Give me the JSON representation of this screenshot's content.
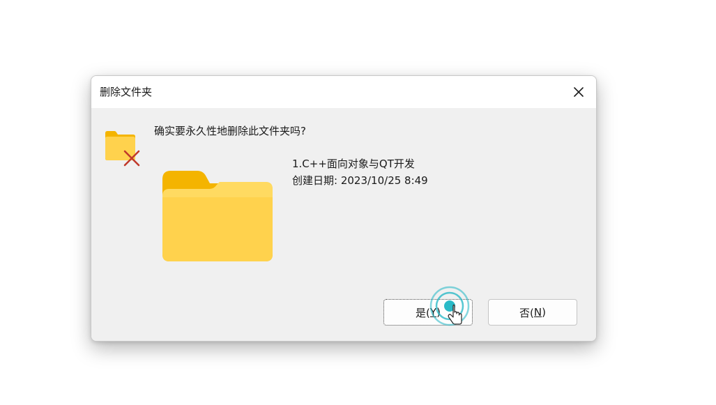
{
  "dialog": {
    "title": "删除文件夹",
    "question": "确实要永久性地删除此文件夹吗?",
    "file_name": "1.C++面向对象与QT开发",
    "created_label": "创建日期: 2023/10/25 8:49",
    "yes_button": {
      "label": "是(",
      "accel": "Y",
      "suffix": ")"
    },
    "no_button": {
      "label": "否(",
      "accel": "N",
      "suffix": ")"
    }
  },
  "icons": {
    "close": "close-icon",
    "small_folder": "folder-delete-icon",
    "big_folder": "folder-icon",
    "cursor": "mouse-cursor-icon"
  },
  "colors": {
    "folder_light": "#ffd24d",
    "folder_dark": "#f4b400",
    "delete_x": "#c0392b",
    "ripple": "#1fb6c4"
  }
}
